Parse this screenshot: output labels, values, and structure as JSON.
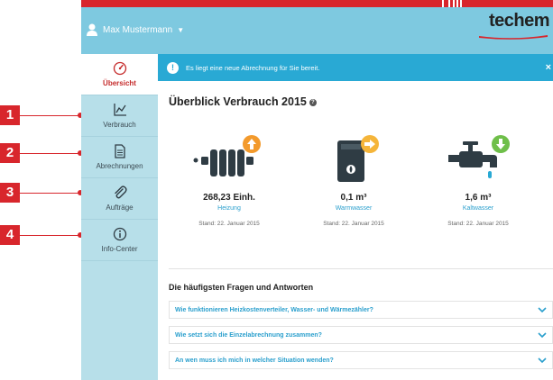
{
  "callouts": [
    "1",
    "2",
    "3",
    "4"
  ],
  "header": {
    "user_name": "Max Mustermann",
    "logo": "techem"
  },
  "sidebar": {
    "items": [
      {
        "label": "Übersicht",
        "icon": "gauge-icon",
        "active": true
      },
      {
        "label": "Verbrauch",
        "icon": "chart-icon",
        "active": false
      },
      {
        "label": "Abrechnungen",
        "icon": "document-icon",
        "active": false
      },
      {
        "label": "Aufträge",
        "icon": "paperclip-icon",
        "active": false
      },
      {
        "label": "Info-Center",
        "icon": "info-icon",
        "active": false
      }
    ]
  },
  "notice": {
    "text": "Es liegt eine neue Abrechnung für Sie bereit.",
    "close": "×"
  },
  "main": {
    "title": "Überblick Verbrauch 2015",
    "meters": [
      {
        "value": "268,23 Einh.",
        "label": "Heizung",
        "stand": "Stand: 22. Januar 2015",
        "trend": "up",
        "badge_color": "#f39a2c"
      },
      {
        "value": "0,1 m³",
        "label": "Warmwasser",
        "stand": "Stand: 22. Januar 2015",
        "trend": "right",
        "badge_color": "#f5b53a"
      },
      {
        "value": "1,6 m³",
        "label": "Kaltwasser",
        "stand": "Stand: 22. Januar 2015",
        "trend": "down",
        "badge_color": "#6fbf4a"
      }
    ],
    "faq_title": "Die häufigsten Fragen und Antworten",
    "faq": [
      "Wie funktionieren Heizkostenverteiler, Wasser- und Wärmezähler?",
      "Wie setzt sich die Einzelabrechnung zusammen?",
      "An wen muss ich mich in welcher Situation wenden?"
    ]
  },
  "colors": {
    "accent_red": "#d8262c",
    "header_blue": "#7ec9e0",
    "notice_blue": "#29a9d4",
    "link_blue": "#2a9fcd",
    "sidebar_bg": "#b7dfe9",
    "icon_dark": "#2f3c44"
  }
}
